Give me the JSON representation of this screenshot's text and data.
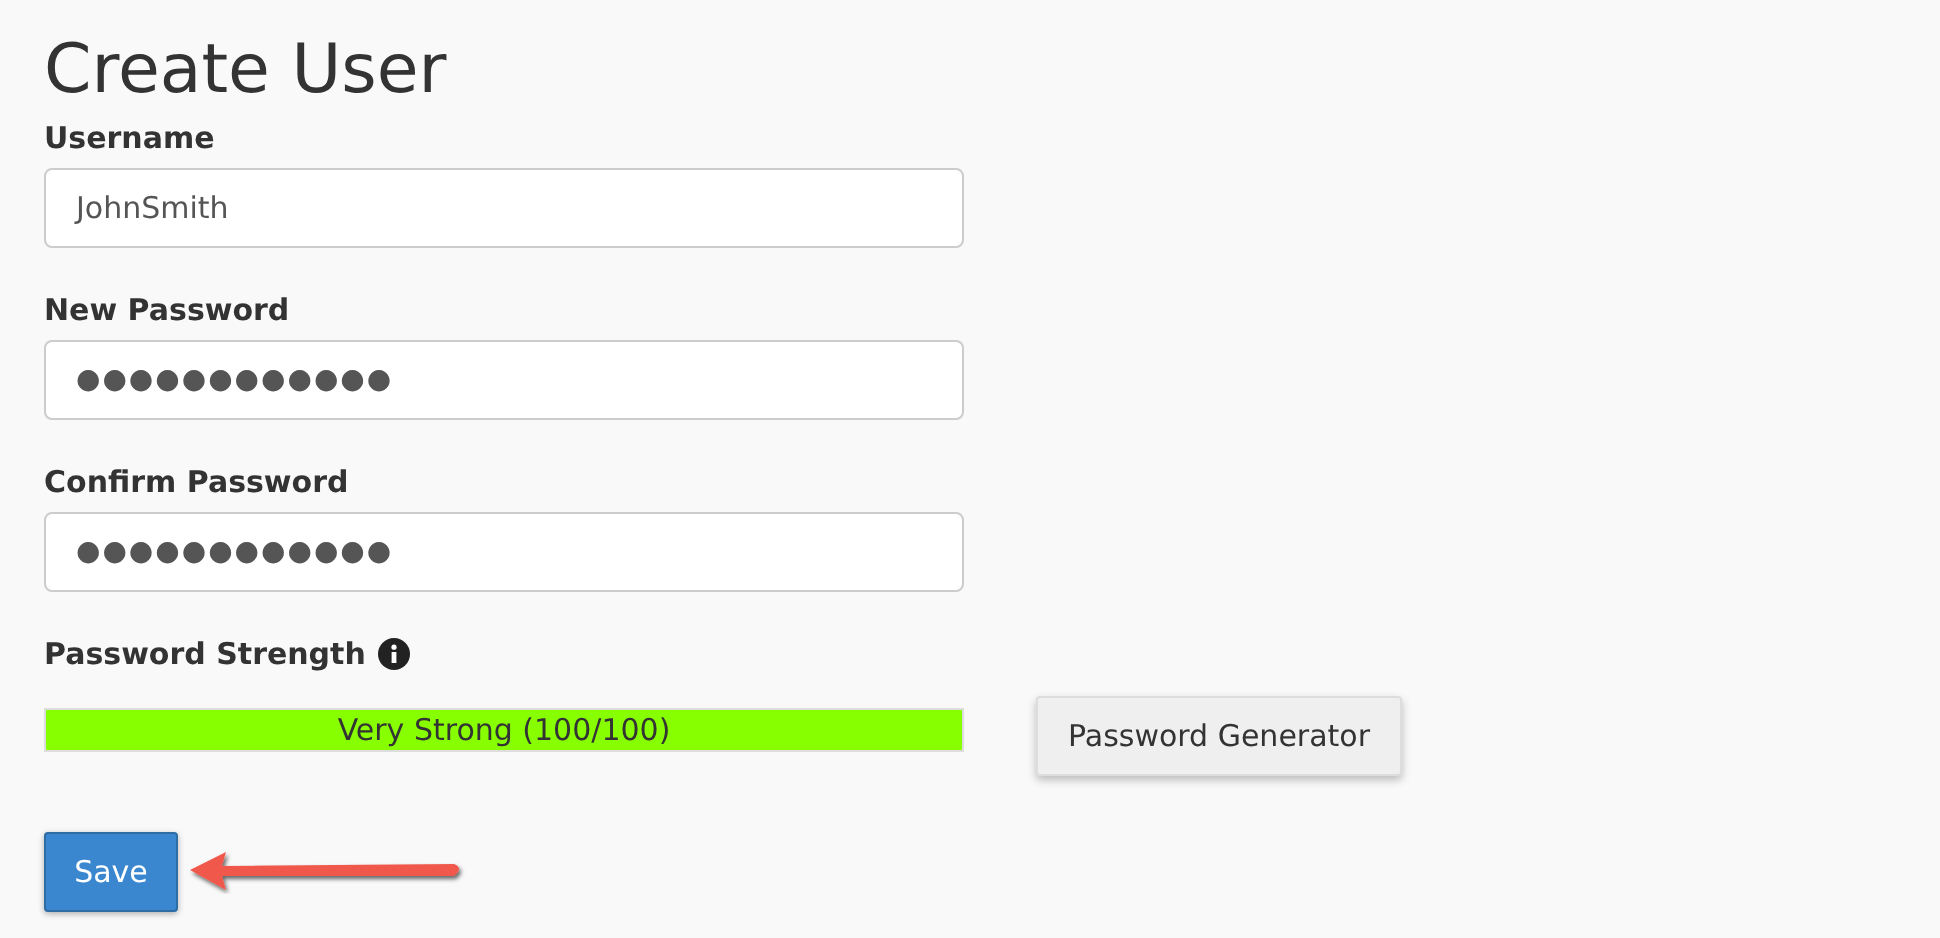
{
  "title": "Create User",
  "fields": [
    {
      "label": "Username",
      "kind": "text",
      "value": "JohnSmith"
    },
    {
      "label": "New Password",
      "kind": "password",
      "value": "●●●●●●●●●●●●"
    },
    {
      "label": "Confirm Password",
      "kind": "password",
      "value": "●●●●●●●●●●●●"
    }
  ],
  "strength": {
    "label": "Password Strength",
    "level": 1,
    "reading": "Very Strong (100/100)"
  },
  "generator_button": "Password Generator",
  "save_button": "Save"
}
